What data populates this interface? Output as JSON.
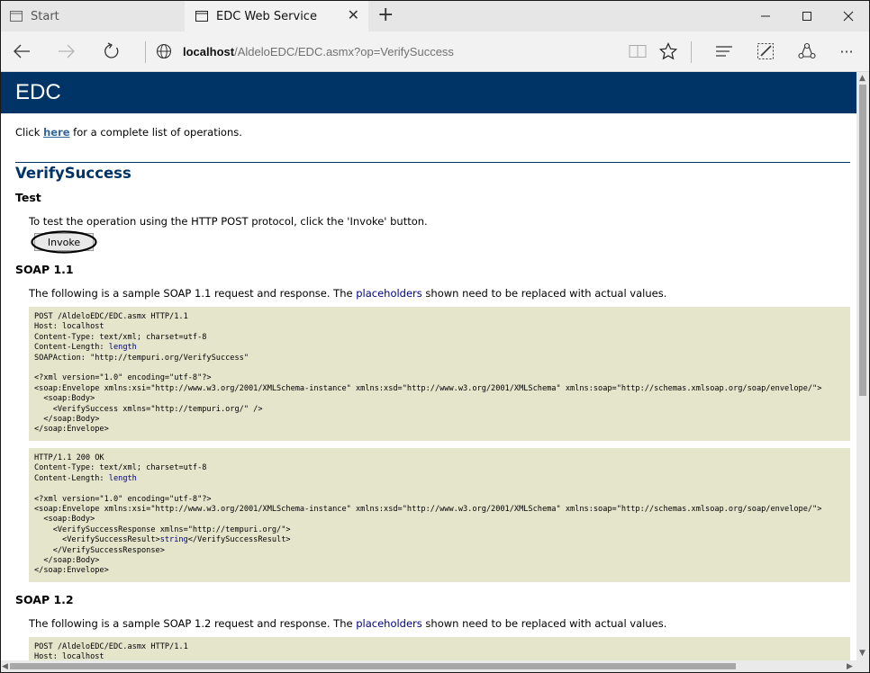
{
  "browser": {
    "tabs": [
      {
        "title": "Start",
        "icon": "tab-page-icon"
      },
      {
        "title": "EDC Web Service",
        "icon": "tab-page-icon",
        "close": "✕"
      }
    ],
    "new_tab": "+",
    "url_host": "localhost",
    "url_path": "/AldeloEDC/EDC.asmx?op=VerifySuccess",
    "window_controls": {
      "minimize": "—",
      "maximize": "☐",
      "close": "✕"
    },
    "more": "···"
  },
  "page": {
    "title": "EDC",
    "intro": {
      "before": "Click ",
      "link": "here",
      "after": " for a complete list of operations."
    },
    "operation": "VerifySuccess",
    "test_heading": "Test",
    "test_text": "To test the operation using the HTTP POST protocol, click the 'Invoke' button.",
    "invoke_label": "Invoke",
    "soap11": {
      "heading": "SOAP 1.1",
      "text_before": "The following is a sample SOAP 1.1 request and response. The ",
      "placeholders": "placeholders",
      "text_after": " shown need to be replaced with actual values.",
      "request_l1": "POST /AldeloEDC/EDC.asmx HTTP/1.1\nHost: localhost\nContent-Type: text/xml; charset=utf-8\nContent-Length: ",
      "request_length": "length",
      "request_l2": "\nSOAPAction: \"http://tempuri.org/VerifySuccess\"\n\n<?xml version=\"1.0\" encoding=\"utf-8\"?>\n<soap:Envelope xmlns:xsi=\"http://www.w3.org/2001/XMLSchema-instance\" xmlns:xsd=\"http://www.w3.org/2001/XMLSchema\" xmlns:soap=\"http://schemas.xmlsoap.org/soap/envelope/\">\n  <soap:Body>\n    <VerifySuccess xmlns=\"http://tempuri.org/\" />\n  </soap:Body>\n</soap:Envelope>",
      "response_l1": "HTTP/1.1 200 OK\nContent-Type: text/xml; charset=utf-8\nContent-Length: ",
      "response_length": "length",
      "response_l2": "\n\n<?xml version=\"1.0\" encoding=\"utf-8\"?>\n<soap:Envelope xmlns:xsi=\"http://www.w3.org/2001/XMLSchema-instance\" xmlns:xsd=\"http://www.w3.org/2001/XMLSchema\" xmlns:soap=\"http://schemas.xmlsoap.org/soap/envelope/\">\n  <soap:Body>\n    <VerifySuccessResponse xmlns=\"http://tempuri.org/\">\n      <VerifySuccessResult>",
      "response_value": "string",
      "response_l3": "</VerifySuccessResult>\n    </VerifySuccessResponse>\n  </soap:Body>\n</soap:Envelope>"
    },
    "soap12": {
      "heading": "SOAP 1.2",
      "text_before": "The following is a sample SOAP 1.2 request and response. The ",
      "placeholders": "placeholders",
      "text_after": " shown need to be replaced with actual values.",
      "request": "POST /AldeloEDC/EDC.asmx HTTP/1.1\nHost: localhost"
    }
  },
  "colors": {
    "header_bg": "#003366",
    "code_bg": "#e5e5cc",
    "link": "#336699",
    "placeholder": "#000080"
  }
}
